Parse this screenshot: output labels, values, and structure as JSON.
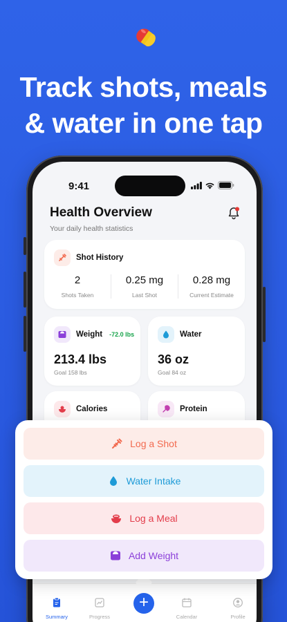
{
  "headline": {
    "line1": "Track shots, meals",
    "line2": "& water in one tap"
  },
  "status_bar": {
    "time": "9:41"
  },
  "header": {
    "title": "Health Overview",
    "subtitle": "Your daily health statistics"
  },
  "shot_history": {
    "title": "Shot History",
    "stats": [
      {
        "value": "2",
        "label": "Shots Taken"
      },
      {
        "value": "0.25 mg",
        "label": "Last Shot"
      },
      {
        "value": "0.28 mg",
        "label": "Current Estimate"
      }
    ]
  },
  "weight": {
    "title": "Weight",
    "delta": "-72.0 lbs",
    "value": "213.4 lbs",
    "goal": "Goal 158 lbs"
  },
  "water": {
    "title": "Water",
    "value": "36 oz",
    "goal": "Goal 84 oz"
  },
  "calories": {
    "title": "Calories"
  },
  "protein": {
    "title": "Protein"
  },
  "actions": [
    {
      "label": "Log a Shot",
      "icon": "syringe-icon",
      "color": "#f26a4f",
      "bg": "#fdece8"
    },
    {
      "label": "Water Intake",
      "icon": "water-drop-icon",
      "color": "#1e9bd7",
      "bg": "#e3f3fb"
    },
    {
      "label": "Log a Meal",
      "icon": "meal-bowl-icon",
      "color": "#e33d4b",
      "bg": "#fde8ea"
    },
    {
      "label": "Add Weight",
      "icon": "scale-icon",
      "color": "#8b3fd9",
      "bg": "#f1e8fb"
    }
  ],
  "tabs": [
    {
      "label": "Summary",
      "icon": "clipboard-icon",
      "active": true
    },
    {
      "label": "Progress",
      "icon": "chart-icon",
      "active": false
    },
    {
      "label": "",
      "icon": "plus-icon",
      "active": false
    },
    {
      "label": "Calendar",
      "icon": "calendar-icon",
      "active": false
    },
    {
      "label": "Profile",
      "icon": "profile-icon",
      "active": false
    }
  ],
  "colors": {
    "background": "#2f63e8",
    "accent": "#2563eb"
  }
}
